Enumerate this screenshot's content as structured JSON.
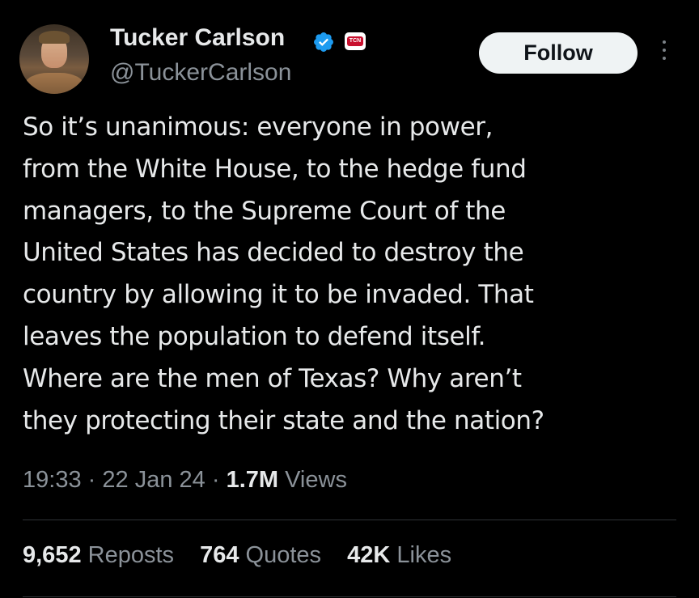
{
  "colors": {
    "background": "#000000",
    "text": "#e7e9ea",
    "secondary_text": "#8b9299",
    "verified_blue": "#1d9bf0",
    "follow_button_bg": "#eff3f4"
  },
  "author": {
    "name": "Tucker Carlson",
    "handle": "@TuckerCarlson",
    "verified_icon": "verified-badge-icon",
    "affiliate_badge": "TCN"
  },
  "header": {
    "follow_label": "Follow",
    "more_icon": "more-vertical-icon"
  },
  "tweet": {
    "lines": [
      "So it’s unanimous: everyone in power,",
      "from the White House, to the hedge fund",
      "managers, to the Supreme Court of the",
      "United States has decided to destroy the",
      "country by allowing it to be invaded. That",
      "leaves the population to defend itself.",
      "Where are the men of Texas? Why aren’t",
      "they protecting their state and the nation?"
    ]
  },
  "meta": {
    "time": "19:33",
    "sep": "·",
    "date": "22 Jan 24",
    "views_count": "1.7M",
    "views_label": "Views"
  },
  "stats": {
    "reposts_count": "9,652",
    "reposts_label": "Reposts",
    "quotes_count": "764",
    "quotes_label": "Quotes",
    "likes_count": "42K",
    "likes_label": "Likes"
  }
}
